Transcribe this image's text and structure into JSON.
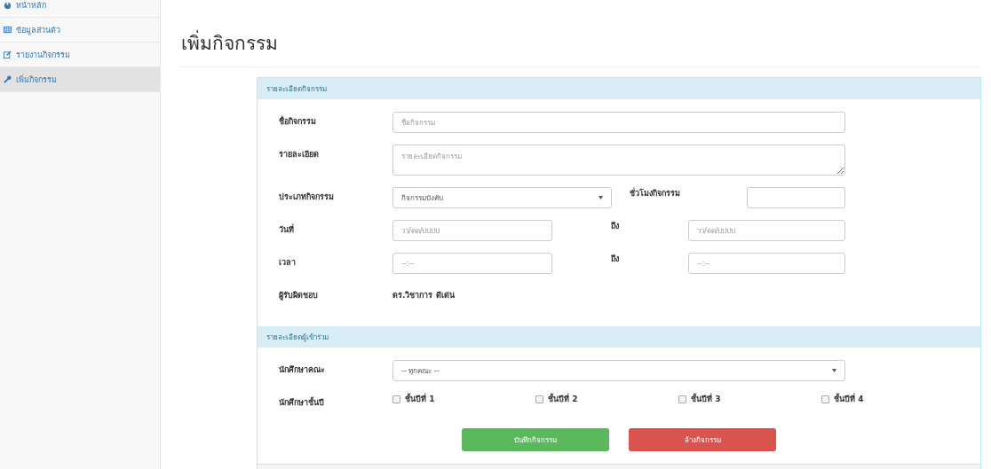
{
  "sidebar": {
    "items": [
      {
        "label": "หน้าหลัก",
        "selected": false
      },
      {
        "label": "ข้อมูลส่วนตัว",
        "selected": false
      },
      {
        "label": "รายงานกิจกรรม",
        "selected": false
      },
      {
        "label": "เพิ่มกิจกรรม",
        "selected": true
      }
    ]
  },
  "page_title": "เพิ่มกิจกรรม",
  "activity_panel": {
    "heading": "รายละเอียดกิจกรรม",
    "name": {
      "label": "ชื่อกิจกรรม",
      "placeholder": "ชื่อกิจกรรม"
    },
    "details": {
      "label": "รายละเอียด",
      "placeholder": "รายละเอียดกิจกรรม"
    },
    "type": {
      "label": "ประเภทกิจกรรม",
      "value": "กิจกรรมบังคับ"
    },
    "hours": {
      "label": "ชั่วโมงกิจกรรม"
    },
    "date": {
      "label": "วันที่",
      "from_placeholder": "วว/ดด/ปปปป",
      "to_label": "ถึง",
      "to_placeholder": "วว/ดด/ปปปป"
    },
    "time": {
      "label": "เวลา",
      "from_placeholder": "--:--",
      "to_label": "ถึง",
      "to_placeholder": "--:--"
    },
    "responsible": {
      "label": "ผู้รับผิดชอบ",
      "value": "ดร.วิชาการ ดีเด่น"
    }
  },
  "participants_panel": {
    "heading": "รายละเอียดผู้เข้าร่วม",
    "faculty": {
      "label": "นักศึกษาคณะ",
      "value": "-- ทุกคณะ --"
    },
    "year": {
      "label": "นักศึกษาชั้นปี",
      "options": [
        {
          "label": "ชั้นปีที่ 1",
          "checked": false
        },
        {
          "label": "ชั้นปีที่ 2",
          "checked": false
        },
        {
          "label": "ชั้นปีที่ 3",
          "checked": false
        },
        {
          "label": "ชั้นปีที่ 4",
          "checked": false
        }
      ]
    }
  },
  "buttons": [
    {
      "label": "บันทึกกิจกรรม",
      "kind": "save"
    },
    {
      "label": "ล้างกิจกรรม",
      "kind": "clear"
    }
  ]
}
